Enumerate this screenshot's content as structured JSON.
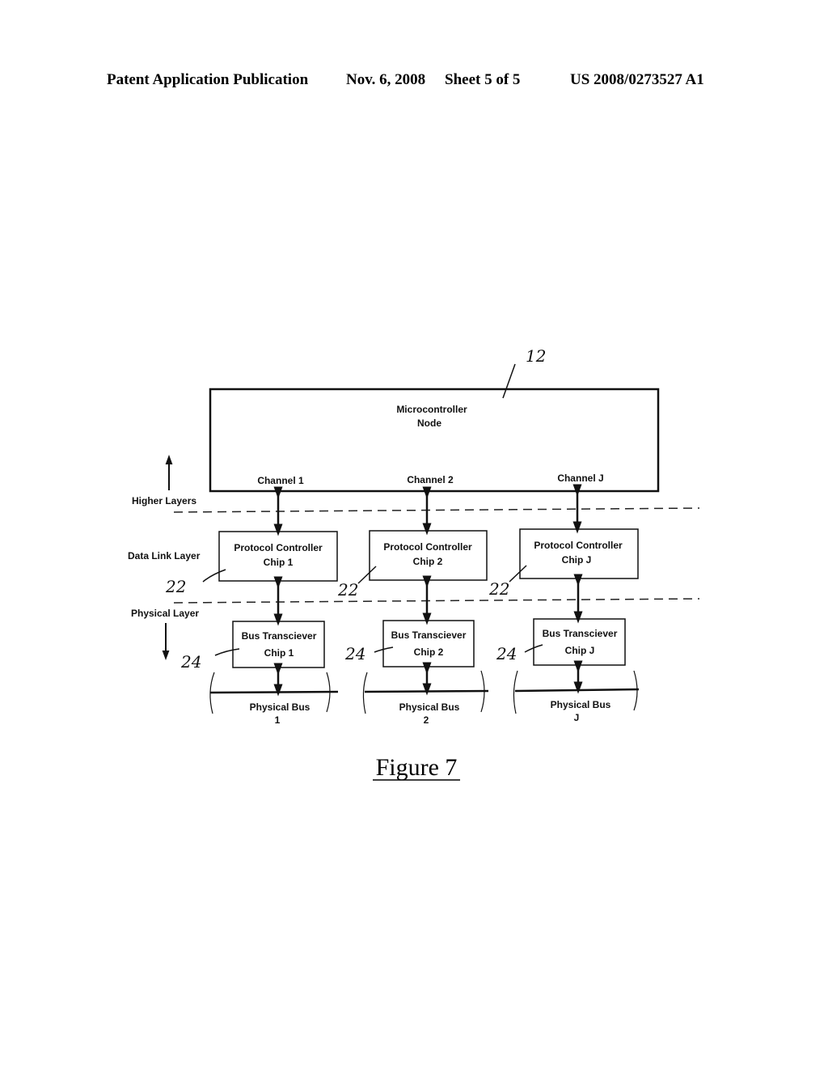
{
  "header": {
    "publication": "Patent Application Publication",
    "date": "Nov. 6, 2008",
    "sheet": "Sheet 5 of 5",
    "patent_number": "US 2008/0273527 A1"
  },
  "diagram": {
    "node": {
      "line1": "Microcontroller",
      "line2": "Node",
      "ref": "12"
    },
    "layers": {
      "higher": "Higher Layers",
      "data_link": "Data Link Layer",
      "physical": "Physical Layer"
    },
    "channels": [
      {
        "channel": "Channel 1",
        "protocol_line1": "Protocol Controller",
        "protocol_line2": "Chip 1",
        "protocol_ref": "22",
        "transceiver_line1": "Bus Transciever",
        "transceiver_line2": "Chip 1",
        "transceiver_ref": "24",
        "bus_line1": "Physical Bus",
        "bus_line2": "1"
      },
      {
        "channel": "Channel 2",
        "protocol_line1": "Protocol Controller",
        "protocol_line2": "Chip 2",
        "protocol_ref": "22",
        "transceiver_line1": "Bus Transciever",
        "transceiver_line2": "Chip 2",
        "transceiver_ref": "24",
        "bus_line1": "Physical Bus",
        "bus_line2": "2"
      },
      {
        "channel": "Channel J",
        "protocol_line1": "Protocol Controller",
        "protocol_line2": "Chip J",
        "protocol_ref": "22",
        "transceiver_line1": "Bus Transciever",
        "transceiver_line2": "Chip J",
        "transceiver_ref": "24",
        "bus_line1": "Physical Bus",
        "bus_line2": "J"
      }
    ],
    "caption": "Figure 7"
  }
}
